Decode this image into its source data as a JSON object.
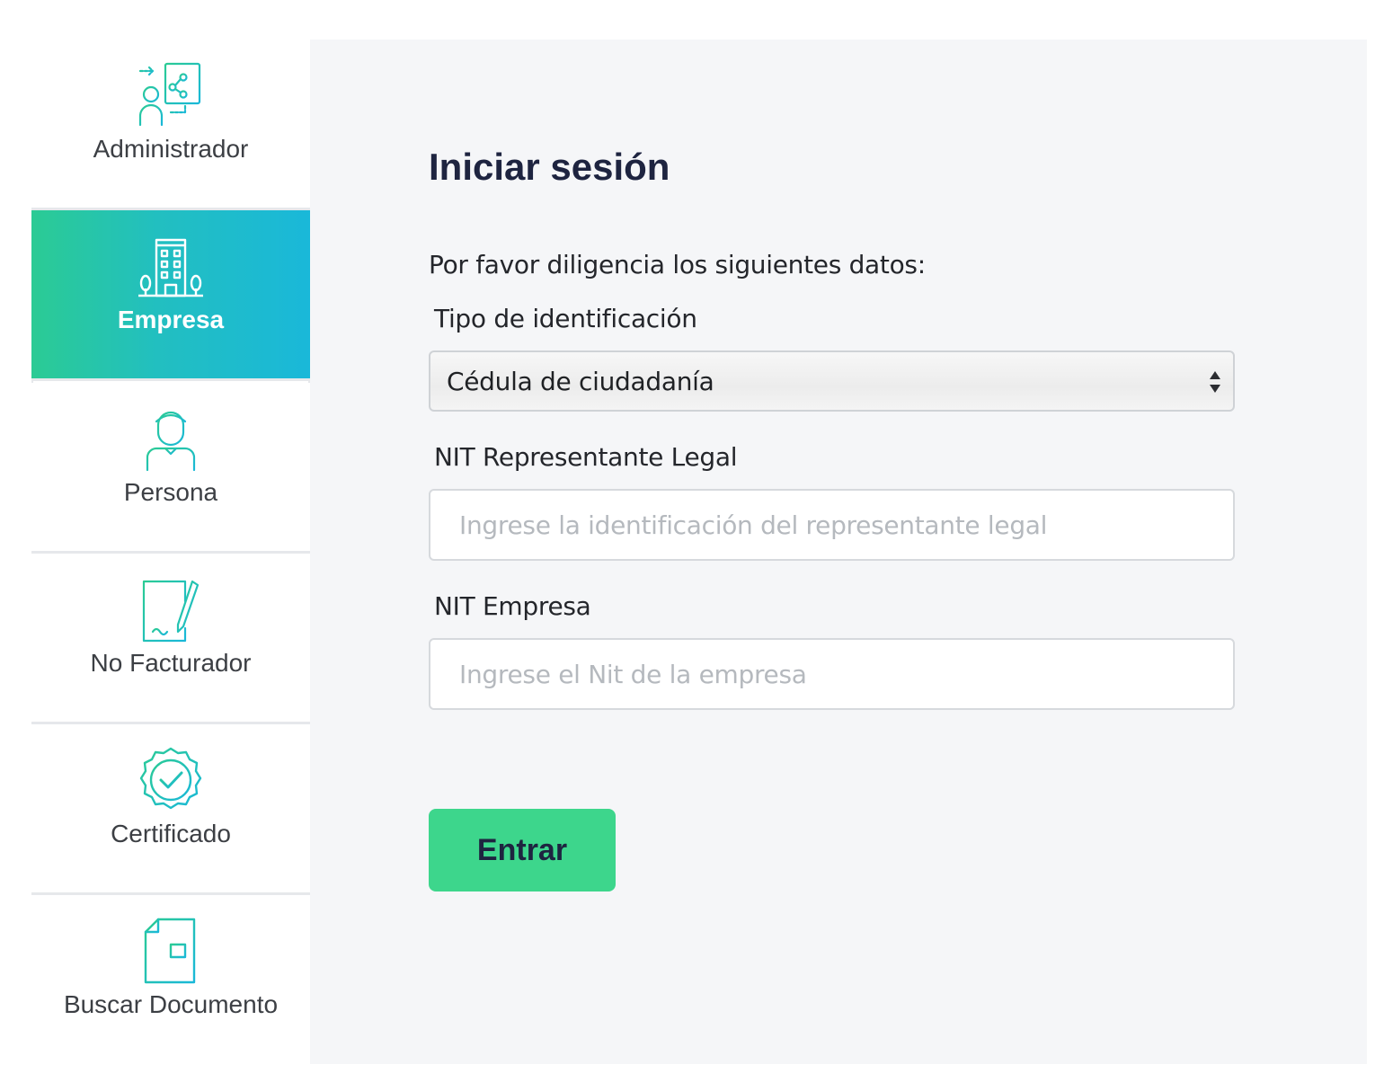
{
  "colors": {
    "accent_green": "#3dd68c",
    "active_gradient_start": "#2bcb94",
    "active_gradient_end": "#1ab8d9",
    "icon_teal": "#22b8c8",
    "title_navy": "#1e2440"
  },
  "sidebar": {
    "items": [
      {
        "label": "Administrador",
        "icon": "admin-network-icon",
        "active": false
      },
      {
        "label": "Empresa",
        "icon": "building-icon",
        "active": true
      },
      {
        "label": "Persona",
        "icon": "person-icon",
        "active": false
      },
      {
        "label": "No Facturador",
        "icon": "document-pen-icon",
        "active": false
      },
      {
        "label": "Certificado",
        "icon": "certificate-badge-icon",
        "active": false
      },
      {
        "label": "Buscar Documento",
        "icon": "search-document-icon",
        "active": false
      }
    ]
  },
  "form": {
    "title": "Iniciar sesión",
    "subtitle": "Por favor diligencia los siguientes datos:",
    "id_type": {
      "label": "Tipo de identificación",
      "selected": "Cédula de ciudadanía"
    },
    "nit_rep": {
      "label": "NIT Representante Legal",
      "placeholder": "Ingrese la identificación del representante legal",
      "value": ""
    },
    "nit_company": {
      "label": "NIT Empresa",
      "placeholder": "Ingrese el Nit de la empresa",
      "value": ""
    },
    "submit_label": "Entrar"
  }
}
